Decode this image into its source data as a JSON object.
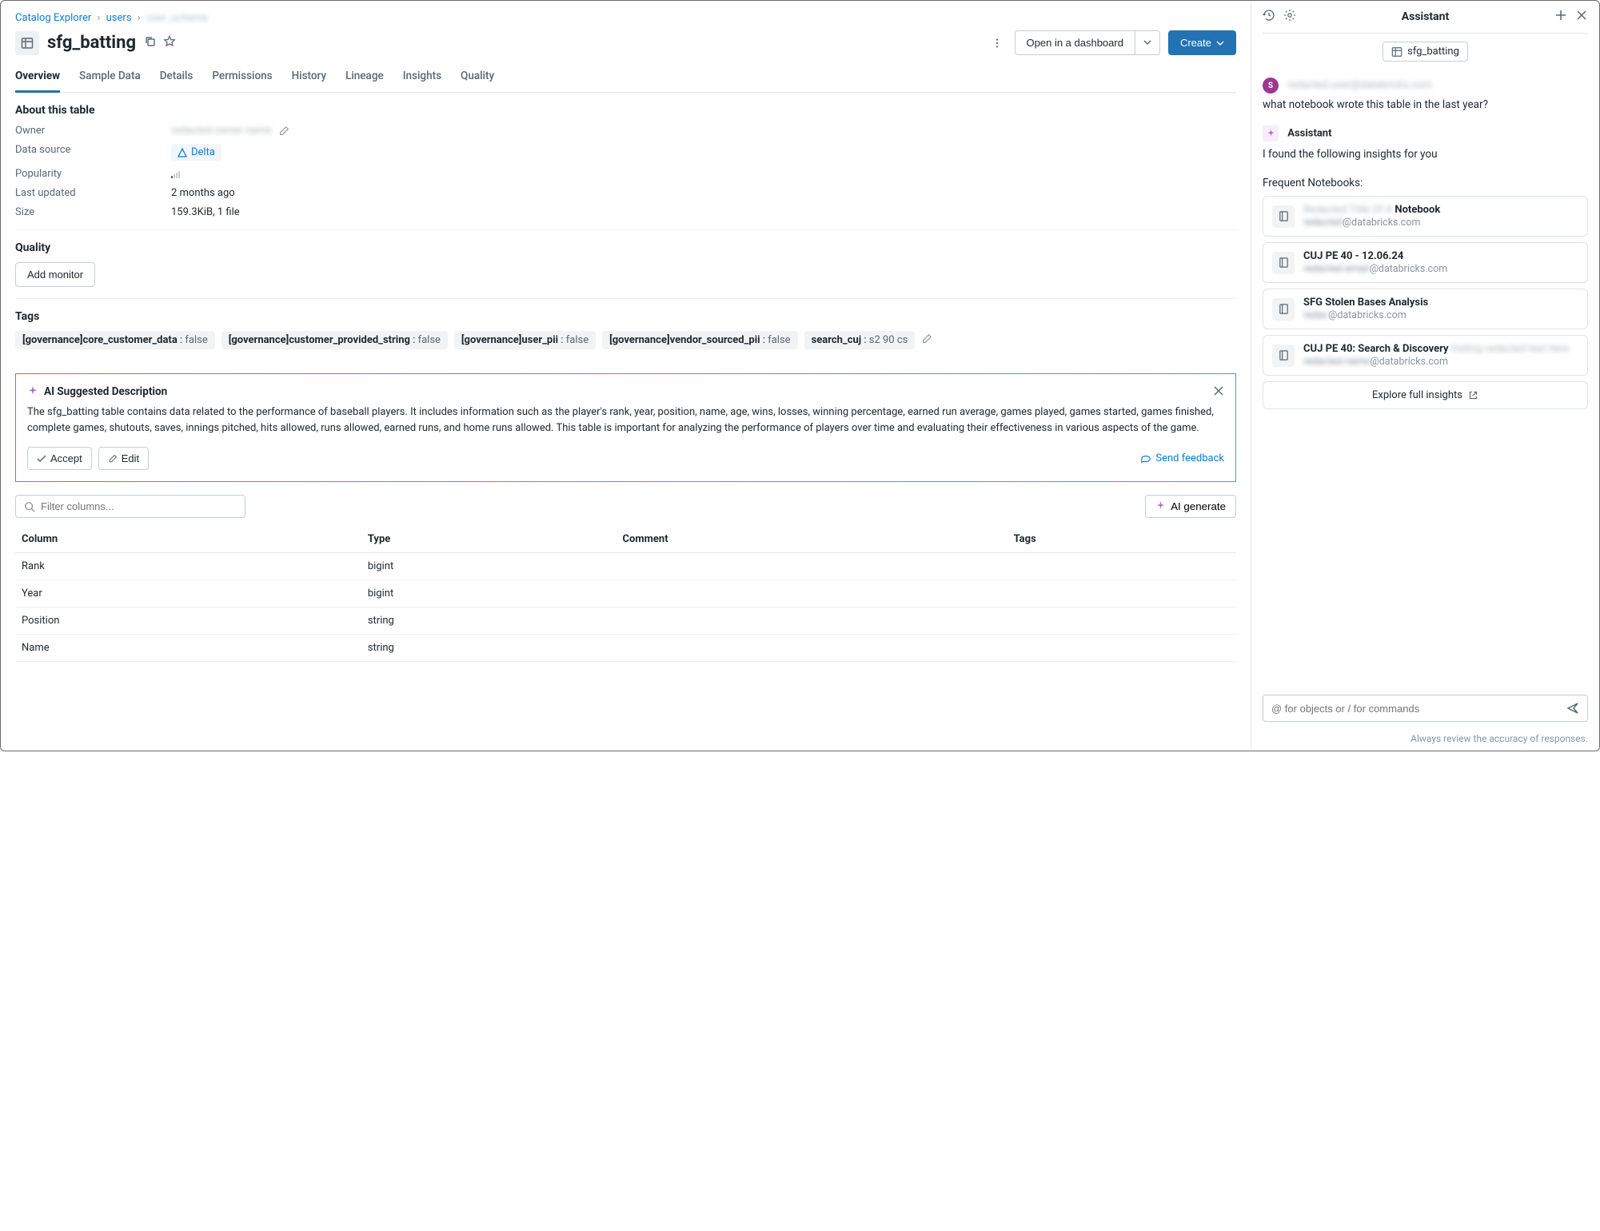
{
  "breadcrumb": {
    "root": "Catalog Explorer",
    "schema": "users",
    "last_blurred": "user_schema"
  },
  "title": "sfg_batting",
  "toolbar": {
    "open_dashboard": "Open in a dashboard",
    "create": "Create"
  },
  "tabs": [
    "Overview",
    "Sample Data",
    "Details",
    "Permissions",
    "History",
    "Lineage",
    "Insights",
    "Quality"
  ],
  "about": {
    "heading": "About this table",
    "owner_label": "Owner",
    "owner_value_blurred": "redacted owner name",
    "datasource_label": "Data source",
    "datasource_value": "Delta",
    "popularity_label": "Popularity",
    "last_updated_label": "Last updated",
    "last_updated_value": "2 months ago",
    "size_label": "Size",
    "size_value": "159.3KiB, 1 file"
  },
  "quality": {
    "heading": "Quality",
    "add_monitor": "Add monitor"
  },
  "tags": {
    "heading": "Tags",
    "items": [
      {
        "k": "[governance]core_customer_data",
        "v": "false"
      },
      {
        "k": "[governance]customer_provided_string",
        "v": "false"
      },
      {
        "k": "[governance]user_pii",
        "v": "false"
      },
      {
        "k": "[governance]vendor_sourced_pii",
        "v": "false"
      },
      {
        "k": "search_cuj",
        "v": "s2 90 cs"
      }
    ]
  },
  "ai": {
    "title": "AI Suggested Description",
    "body": "The sfg_batting table contains data related to the performance of baseball players. It includes information such as the player's rank, year, position, name, age, wins, losses, winning percentage, earned run average, games played, games started, games finished, complete games, shutouts, saves, innings pitched, hits allowed, runs allowed, earned runs, and home runs allowed. This table is important for analyzing the performance of players over time and evaluating their effectiveness in various aspects of the game.",
    "accept": "Accept",
    "edit": "Edit",
    "feedback": "Send feedback"
  },
  "columns": {
    "filter_placeholder": "Filter columns...",
    "ai_generate": "AI generate",
    "headers": [
      "Column",
      "Type",
      "Comment",
      "Tags"
    ],
    "rows": [
      {
        "name": "Rank",
        "type": "bigint"
      },
      {
        "name": "Year",
        "type": "bigint"
      },
      {
        "name": "Position",
        "type": "string"
      },
      {
        "name": "Name",
        "type": "string"
      }
    ]
  },
  "assistant": {
    "title": "Assistant",
    "context": "sfg_batting",
    "user_name_blurred": "redacted.user@databricks.com",
    "user_msg": "what notebook wrote this table in the last year?",
    "asst_name": "Assistant",
    "asst_msg": "I found the following insights for you",
    "insights_heading": "Frequent Notebooks:",
    "notebooks": [
      {
        "title_blur": "Redacted Title Of A ",
        "title_bold": "Notebook",
        "sub_blur": "redacted",
        "sub": "@databricks.com"
      },
      {
        "title_bold": "CUJ PE 40 - 12.06.24",
        "sub_blur": "redacted.email",
        "sub": "@databricks.com"
      },
      {
        "title_bold": "SFG Stolen Bases Analysis",
        "sub_blur": "redac",
        "sub": "@databricks.com"
      },
      {
        "title_bold": "CUJ PE 40: Search & Discovery",
        "title_trail_blur": " trailing redacted text here",
        "sub_blur": "redacted.name",
        "sub": "@databricks.com"
      }
    ],
    "explore": "Explore full insights",
    "input_placeholder": "@ for objects or / for commands",
    "disclaimer": "Always review the accuracy of responses."
  }
}
